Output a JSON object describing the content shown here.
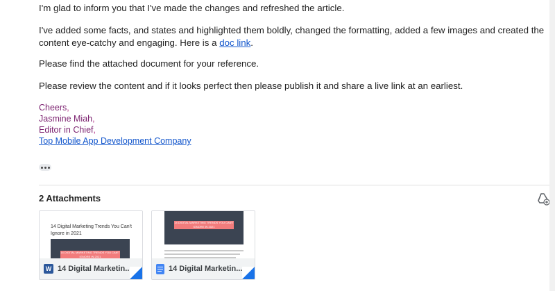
{
  "email": {
    "para1": "I'm glad to inform you that I've made the changes and refreshed the article.",
    "para2_text": "I've added some facts, and states and highlighted them boldly, changed the formatting, added a few images and created the content eye-catchy and engaging. Here is a ",
    "para2_link": "doc link",
    "para2_end": ".",
    "para3": "Please find the attached document for your reference.",
    "para4": "Please review the content and if it looks perfect then please publish it and share a live link at an earliest.",
    "signature": {
      "cheers": "Cheers",
      "name": "Jasmine Miah",
      "title": "Editor in Chief",
      "company_link": "Top Mobile App Development Company",
      "comma": ","
    }
  },
  "attachments": {
    "heading": "2 Attachments",
    "items": [
      {
        "filename": "14 Digital Marketin...",
        "type": "word",
        "type_letter": "W",
        "thumb_title": "14 Digital Marketing Trends You Can't Ignore in 2021",
        "banner_text": "14 DIGITAL MARKETING TRENDS YOU CAN'T IGNORE IN 2021"
      },
      {
        "filename": "14 Digital Marketin...",
        "type": "gdoc",
        "banner_text": "14 DIGITAL MARKETING TRENDS YOU CAN'T IGNORE IN 2021"
      }
    ]
  },
  "colors": {
    "link": "#1155cc",
    "signature": "#7a1f6e",
    "banner": "#f27c7c",
    "word": "#2b579a",
    "gdoc": "#4285f4"
  }
}
